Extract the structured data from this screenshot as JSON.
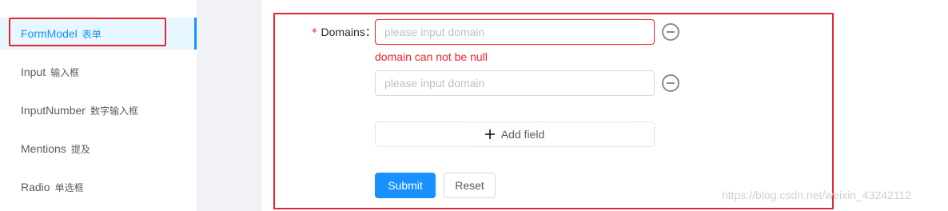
{
  "sidebar": {
    "items": [
      {
        "label": "FormModel",
        "sub": "表单"
      },
      {
        "label": "Input",
        "sub": "输入框"
      },
      {
        "label": "InputNumber",
        "sub": "数字输入框"
      },
      {
        "label": "Mentions",
        "sub": "提及"
      },
      {
        "label": "Radio",
        "sub": "单选框"
      }
    ],
    "active_index": 0
  },
  "form": {
    "required_mark": "*",
    "domains_label": "Domains",
    "label_colon": "：",
    "domains": [
      {
        "value": "",
        "placeholder": "please input domain",
        "error": "domain can not be null"
      },
      {
        "value": "",
        "placeholder": "please input domain"
      }
    ],
    "add_field_label": "Add field",
    "submit_label": "Submit",
    "reset_label": "Reset"
  },
  "watermark": "https://blog.csdn.net/weixin_43242112",
  "colors": {
    "primary": "#1890ff",
    "error": "#f5222d",
    "annotation": "#e8252f"
  },
  "icons": {
    "remove": "minus-circle-icon",
    "add": "plus-icon"
  }
}
